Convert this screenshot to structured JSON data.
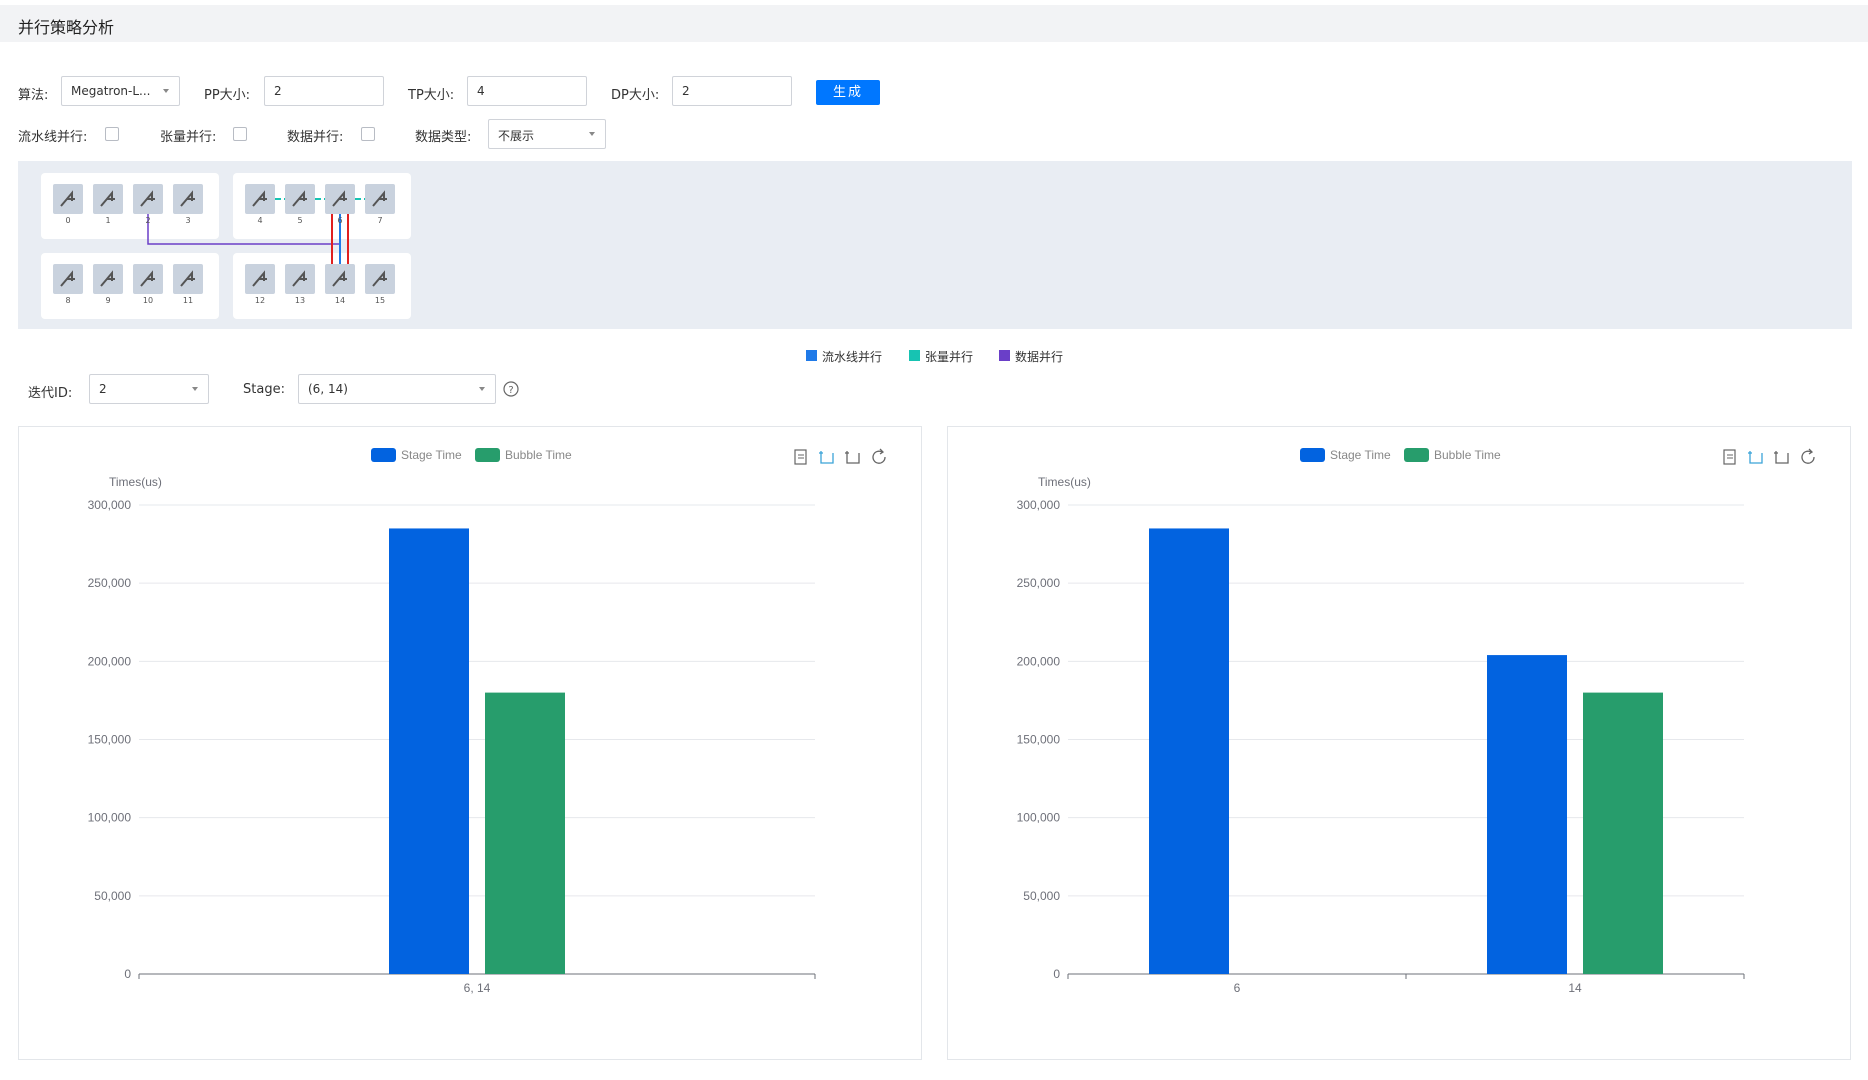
{
  "page": {
    "title": "并行策略分析"
  },
  "controls": {
    "algorithm_label": "算法:",
    "algorithm_value": "Megatron-L...",
    "pp_label": "PP大小:",
    "pp_value": "2",
    "tp_label": "TP大小:",
    "tp_value": "4",
    "dp_label": "DP大小:",
    "dp_value": "2",
    "generate_label": "生成",
    "pipeline_label": "流水线并行:",
    "tensor_label": "张量并行:",
    "data_label": "数据并行:",
    "datatype_label": "数据类型:",
    "datatype_value": "不展示"
  },
  "topology": {
    "groups": [
      {
        "devices": [
          "0",
          "1",
          "2",
          "3"
        ]
      },
      {
        "devices": [
          "4",
          "5",
          "6",
          "7"
        ]
      },
      {
        "devices": [
          "8",
          "9",
          "10",
          "11"
        ]
      },
      {
        "devices": [
          "12",
          "13",
          "14",
          "15"
        ]
      }
    ],
    "colors": {
      "pipeline": "#1f7ae8",
      "tensor": "#17c3b2",
      "data": "#6a3fc8",
      "highlight": "#e02020"
    }
  },
  "legend": {
    "pipeline": "流水线并行",
    "tensor": "张量并行",
    "data": "数据并行"
  },
  "filters": {
    "iteration_label": "迭代ID:",
    "iteration_value": "2",
    "stage_label": "Stage:",
    "stage_value": "(6, 14)",
    "help_icon": "question-circle-icon"
  },
  "chart_data": [
    {
      "type": "bar",
      "ylabel": "Times(us)",
      "ylim": [
        0,
        300000
      ],
      "yticks": [
        "300,000",
        "250,000",
        "200,000",
        "150,000",
        "100,000",
        "50,000",
        "0"
      ],
      "categories": [
        "6, 14"
      ],
      "series": [
        {
          "name": "Stage Time",
          "color": "#0263e0",
          "values": [
            285000
          ]
        },
        {
          "name": "Bubble Time",
          "color": "#279d6c",
          "values": [
            180000
          ]
        }
      ],
      "legend_position": "top-center",
      "grid": true
    },
    {
      "type": "bar",
      "ylabel": "Times(us)",
      "ylim": [
        0,
        300000
      ],
      "yticks": [
        "300,000",
        "250,000",
        "200,000",
        "150,000",
        "100,000",
        "50,000",
        "0"
      ],
      "categories": [
        "6",
        "14"
      ],
      "series": [
        {
          "name": "Stage Time",
          "color": "#0263e0",
          "values": [
            285000,
            204000
          ]
        },
        {
          "name": "Bubble Time",
          "color": "#279d6c",
          "values": [
            null,
            180000
          ]
        }
      ],
      "legend_position": "top-center",
      "grid": true
    }
  ]
}
